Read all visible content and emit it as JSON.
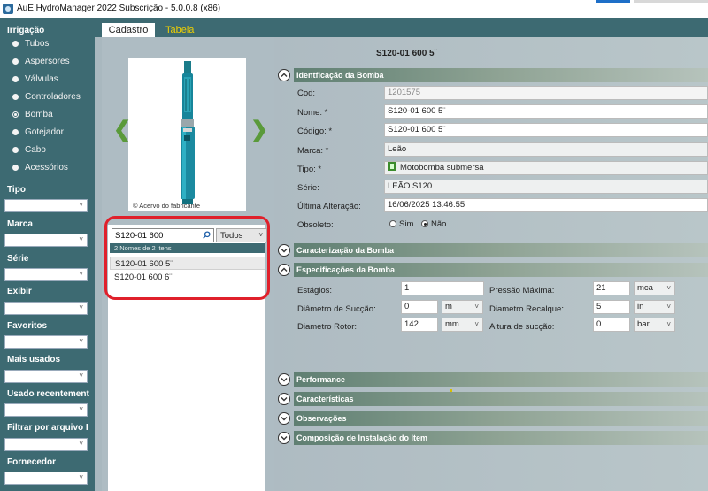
{
  "window": {
    "title": "AuE HydroManager 2022 Subscrição - 5.0.0.8 (x86)"
  },
  "sidebar": {
    "irrigacao_label": "Irrigação",
    "items": [
      "Tubos",
      "Aspersores",
      "Válvulas",
      "Controladores",
      "Bomba",
      "Gotejador",
      "Cabo",
      "Acessórios"
    ],
    "selected": "Bomba",
    "filters": [
      "Tipo",
      "Marca",
      "Série",
      "Exibir",
      "Favoritos",
      "Mais usados",
      "Usado recentement",
      "Filtrar por arquivo I",
      "Fornecedor"
    ]
  },
  "tabs": {
    "cadastro": "Cadastro",
    "tabela": "Tabela"
  },
  "product": {
    "title": "S120-01 600 5¨",
    "image_caption": "© Acervo do fabricante"
  },
  "search": {
    "value": "S120-01 600",
    "filter": "Todos",
    "count": "2 Nomes de 2 itens",
    "results": [
      "S120-01 600 5¨",
      "S120-01 600 6¨"
    ]
  },
  "sections": {
    "identificacao": "Identficação da Bomba",
    "caracterizacao": "Caracterização da Bomba",
    "especificacoes": "Especificações da Bomba",
    "performance": "Performance",
    "caracteristicas": "Características",
    "observacoes": "Observações",
    "composicao": "Composição de Instalação do Item"
  },
  "identificacao": {
    "cod_label": "Cod:",
    "cod": "1201575",
    "nome_label": "Nome: *",
    "nome": "S120-01 600 5¨",
    "codigo_label": "Código: *",
    "codigo": "S120-01 600 5¨",
    "marca_label": "Marca: *",
    "marca": "Leão",
    "tipo_label": "Tipo: *",
    "tipo": "Motobomba submersa",
    "serie_label": "Série:",
    "serie": "LEÃO S120",
    "ultima_label": "Última Alteração:",
    "ultima": "16/06/2025 13:46:55",
    "obsoleto_label": "Obsoleto:",
    "sim": "Sim",
    "nao": "Não",
    "obsoleto_selected": "Não"
  },
  "especificacoes": {
    "estagios_label": "Estágios:",
    "estagios": "1",
    "pressao_label": "Pressão Máxima:",
    "pressao": "21",
    "pressao_unit": "mca",
    "diam_succao_label": "Diâmetro de Sucção:",
    "diam_succao": "0",
    "diam_succao_unit": "m",
    "diam_recalque_label": "Diametro Recalque:",
    "diam_recalque": "5",
    "diam_recalque_unit": "in",
    "diam_rotor_label": "Diametro Rotor:",
    "diam_rotor": "142",
    "diam_rotor_unit": "mm",
    "altura_label": "Altura de sucção:",
    "altura": "0",
    "altura_unit": "bar"
  },
  "colors": {
    "sidebar": "#3d6a72",
    "tab_active": "#ffffff",
    "tab_inactive_text": "#f0d000",
    "highlight": "#e0202b",
    "nav_arrow": "#5a9a3a"
  }
}
